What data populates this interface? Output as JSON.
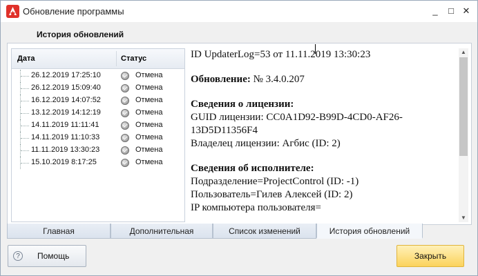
{
  "window": {
    "title": "Обновление программы",
    "minimize_glyph": "_",
    "maximize_glyph": "□",
    "close_glyph": "✕",
    "app_icon": "app-logo-icon",
    "accent": "#e0312a"
  },
  "section_title": "История обновлений",
  "history": {
    "columns": {
      "date": "Дата",
      "status": "Статус"
    },
    "rows": [
      {
        "date": "26.12.2019 17:25:10",
        "status": "Отмена"
      },
      {
        "date": "26.12.2019 15:09:40",
        "status": "Отмена"
      },
      {
        "date": "16.12.2019 14:07:52",
        "status": "Отмена"
      },
      {
        "date": "13.12.2019 14:12:19",
        "status": "Отмена"
      },
      {
        "date": "14.11.2019 11:11:41",
        "status": "Отмена"
      },
      {
        "date": "14.11.2019 11:10:33",
        "status": "Отмена"
      },
      {
        "date": "11.11.2019 13:30:23",
        "status": "Отмена"
      },
      {
        "date": "15.10.2019 8:17:25",
        "status": "Отмена"
      }
    ]
  },
  "detail": {
    "header_line": "ID UpdaterLog=53 от 11.11.2019 13:30:23",
    "update_label": "Обновление:",
    "update_value": " № 3.4.0.207",
    "license_title": "Сведения о лицензии:",
    "license_guid_1": "GUID лицензии: CC0A1D92-B99D-4CD0-AF26-",
    "license_guid_2": "13D5D11356F4",
    "license_owner": "Владелец лицензии: Агбис (ID: 2)",
    "performer_title": "Сведения об исполнителе:",
    "performer_division": "Подразделение=ProjectControl (ID: -1)",
    "performer_user": "Пользователь=Гилев Алексей (ID: 2)",
    "performer_ip": "IP компьютера пользователя="
  },
  "tabs": [
    {
      "label": "Главная"
    },
    {
      "label": "Дополнительная"
    },
    {
      "label": "Список изменений"
    },
    {
      "label": "История обновлений",
      "active": true
    }
  ],
  "buttons": {
    "help": "Помощь",
    "help_icon_glyph": "?",
    "close": "Закрыть"
  }
}
